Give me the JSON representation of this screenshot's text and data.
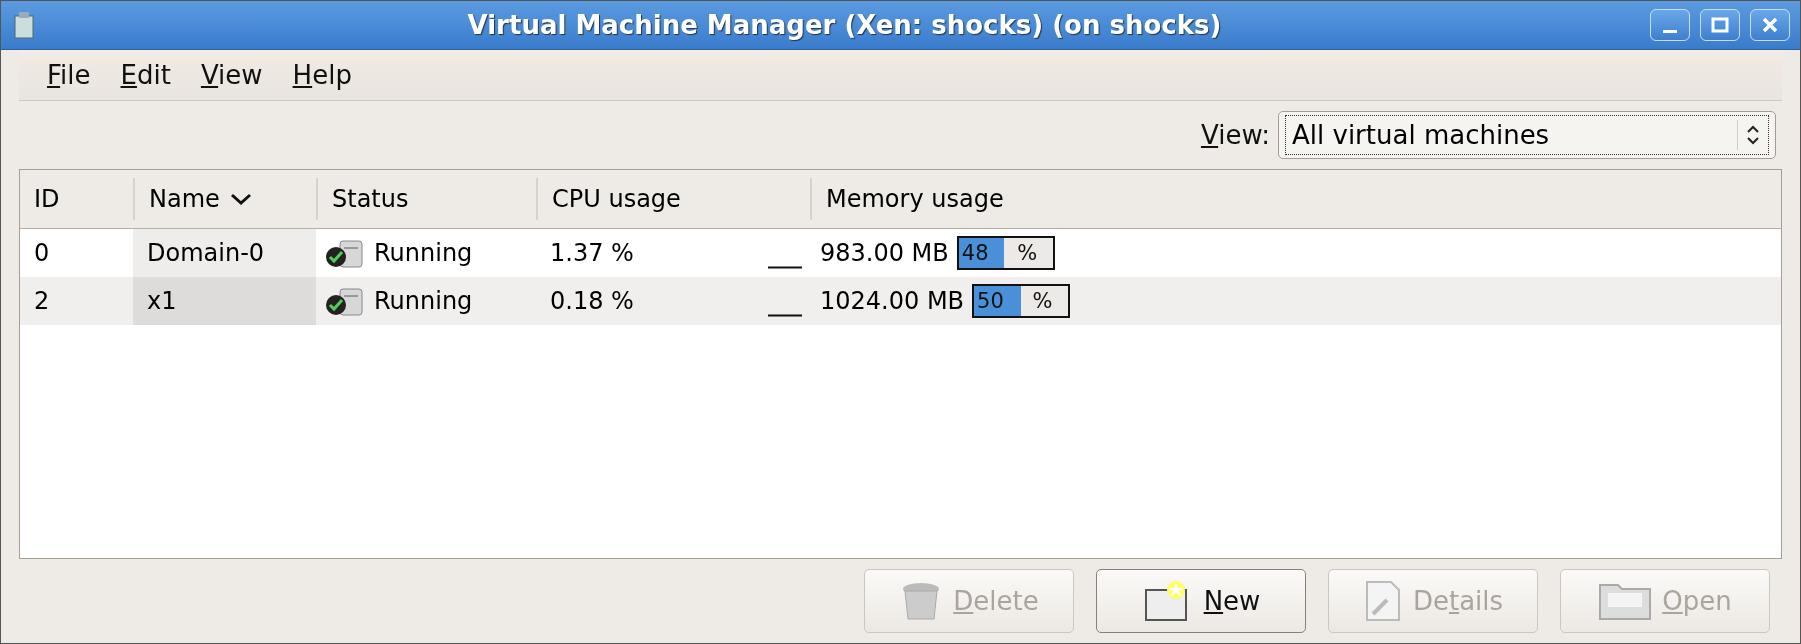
{
  "window": {
    "title": "Virtual Machine Manager (Xen: shocks) (on shocks)"
  },
  "menu": [
    {
      "label": [
        {
          "text": "F",
          "underlined": true
        },
        {
          "text": "ile",
          "underlined": false
        }
      ]
    },
    {
      "label": [
        {
          "text": "E",
          "underlined": true
        },
        {
          "text": "dit",
          "underlined": false
        }
      ]
    },
    {
      "label": [
        {
          "text": "V",
          "underlined": true
        },
        {
          "text": "iew",
          "underlined": false
        }
      ]
    },
    {
      "label": [
        {
          "text": "H",
          "underlined": true
        },
        {
          "text": "elp",
          "underlined": false
        }
      ]
    }
  ],
  "view_filter": {
    "label": [
      {
        "text": "V",
        "underlined": true
      },
      {
        "text": "iew:",
        "underlined": false
      }
    ],
    "value": "All virtual machines"
  },
  "table": {
    "columns": [
      {
        "label": "ID",
        "sorted": false
      },
      {
        "label": "Name",
        "sorted": true
      },
      {
        "label": "Status",
        "sorted": false
      },
      {
        "label": "CPU usage",
        "sorted": false
      },
      {
        "label": "Memory usage",
        "sorted": false
      }
    ],
    "rows": [
      {
        "vm_id": "0",
        "name": "Domain-0",
        "status": "Running",
        "cpu": "1.37 %",
        "memory": "983.00 MB",
        "memory_bar": {
          "level": 0.48,
          "reading": "48 %"
        }
      },
      {
        "vm_id": "2",
        "name": "x1",
        "status": "Running",
        "cpu": "0.18 %",
        "memory": "1024.00 MB",
        "memory_bar": {
          "level": 0.5,
          "reading": "50 %"
        }
      }
    ]
  },
  "buttons": [
    {
      "label": [
        {
          "text": "D",
          "underlined": true
        },
        {
          "text": "elete",
          "underlined": false
        }
      ],
      "disabled": true,
      "kind": "delete"
    },
    {
      "label": [
        {
          "text": "N",
          "underlined": true
        },
        {
          "text": "ew",
          "underlined": false
        }
      ],
      "disabled": false,
      "kind": "new"
    },
    {
      "label": [
        {
          "text": "De",
          "underlined": false
        },
        {
          "text": "t",
          "underlined": true
        },
        {
          "text": "ails",
          "underlined": false
        }
      ],
      "disabled": true,
      "kind": "details"
    },
    {
      "label": [
        {
          "text": "O",
          "underlined": true
        },
        {
          "text": "pen",
          "underlined": false
        }
      ],
      "disabled": true,
      "kind": "open"
    }
  ]
}
